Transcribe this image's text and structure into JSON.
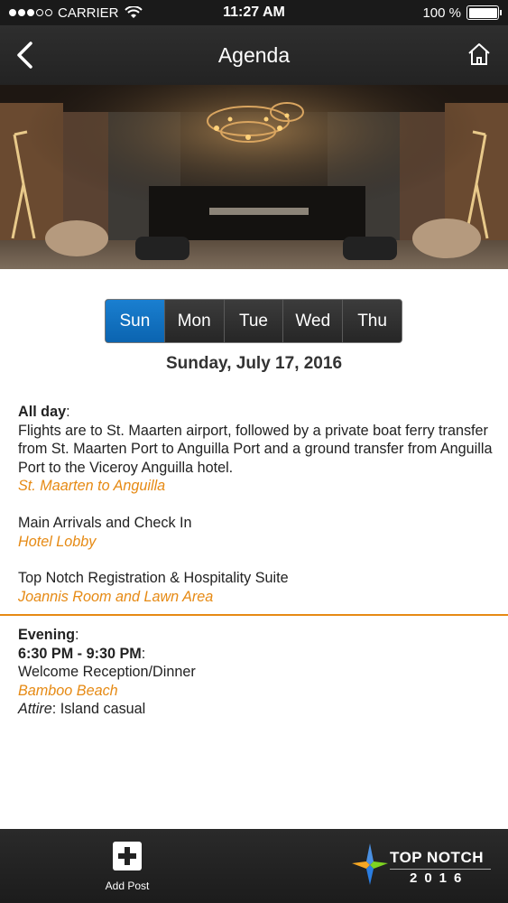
{
  "status": {
    "carrier": "CARRIER",
    "time": "11:27 AM",
    "battery": "100 %",
    "battery_level": 1.0
  },
  "nav": {
    "title": "Agenda"
  },
  "tabs": [
    {
      "label": "Sun",
      "selected": true
    },
    {
      "label": "Mon",
      "selected": false
    },
    {
      "label": "Tue",
      "selected": false
    },
    {
      "label": "Wed",
      "selected": false
    },
    {
      "label": "Thu",
      "selected": false
    }
  ],
  "date_heading": "Sunday, July 17, 2016",
  "allday": {
    "label": "All day",
    "description": "Flights are to St. Maarten airport, followed by a private boat ferry transfer from St. Maarten Port to Anguilla Port and a ground transfer from Anguilla Port to the Viceroy Anguilla hotel.",
    "location": "St. Maarten to Anguilla"
  },
  "items": [
    {
      "title": "Main Arrivals and Check In",
      "location": "Hotel Lobby"
    },
    {
      "title": "Top Notch Registration & Hospitality Suite",
      "location": "Joannis Room and Lawn Area"
    }
  ],
  "evening": {
    "label": "Evening",
    "time": "6:30 PM - 9:30 PM",
    "title": "Welcome Reception/Dinner",
    "location": "Bamboo Beach",
    "attire_label": "Attire",
    "attire_value": "Island casual"
  },
  "bottom": {
    "add_post": "Add Post",
    "brand_name": "TOP NOTCH",
    "brand_year": "2016"
  },
  "colors": {
    "accent": "#e68a14",
    "active_tab": "#0b64b0",
    "bar": "#232323"
  }
}
